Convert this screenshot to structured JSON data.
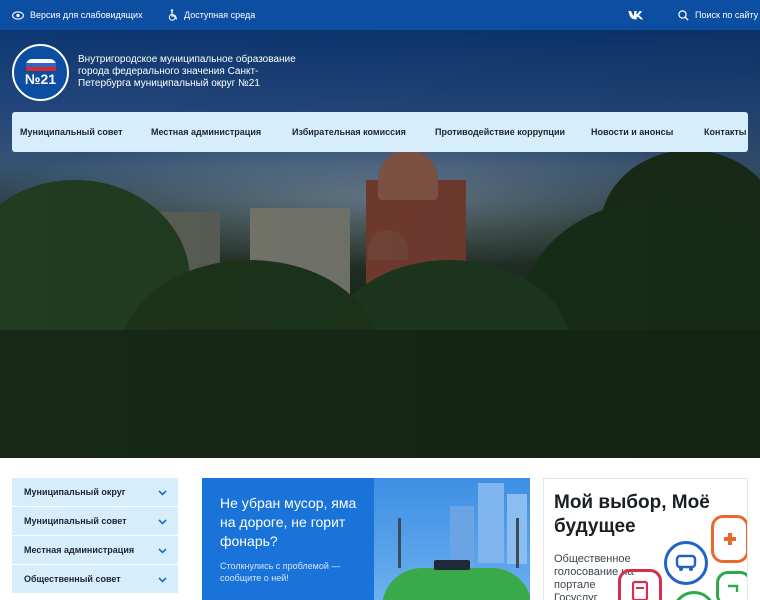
{
  "topbar": {
    "vision_label": "Версия для слабовидящих",
    "accessible_label": "Доступная среда",
    "vk_label": "VK",
    "search_label": "Поиск по сайту",
    "bg_color": "#0b4ea2"
  },
  "header": {
    "logo_number": "№21",
    "title": "Внутригородское муниципальное образование города федерального значения Санкт-Петербурга муниципальный округ №21"
  },
  "nav": {
    "items": [
      {
        "label": "Муниципальный совет"
      },
      {
        "label": "Местная администрация"
      },
      {
        "label": "Избирательная комиссия"
      },
      {
        "label": "Противодействие коррупции"
      },
      {
        "label": "Новости и анонсы"
      },
      {
        "label": "Контакты"
      }
    ],
    "bg_color": "#d6edfb"
  },
  "sidebar": {
    "items": [
      {
        "label": "Муниципальный округ"
      },
      {
        "label": "Муниципальный совет"
      },
      {
        "label": "Местная администрация"
      },
      {
        "label": "Общественный совет"
      }
    ]
  },
  "banner_problem": {
    "headline": "Не убран мусор, яма на дороге, не горит фонарь?",
    "sub": "Столкнулись с проблемой — сообщите о ней!"
  },
  "banner_vote": {
    "headline": "Мой выбор, Моё будущее",
    "sub": "Общественное голосование на портале Госуслуг"
  }
}
